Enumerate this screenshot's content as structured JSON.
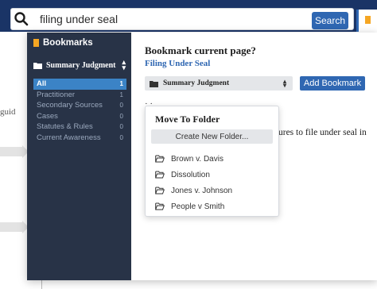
{
  "search": {
    "value": "filing under seal",
    "button_label": "Search",
    "icon": "search-icon"
  },
  "background": {
    "left_fragment": "guid",
    "right_fragment": "ures to file under seal in",
    "under_select_fragment": "· ·"
  },
  "sidebar": {
    "header": "Bookmarks",
    "selected_folder": "Summary Judgment",
    "items": [
      {
        "label": "All",
        "count": "1",
        "active": true
      },
      {
        "label": "Practitioner",
        "count": "1",
        "active": false
      },
      {
        "label": "Secondary Sources",
        "count": "0",
        "active": false
      },
      {
        "label": "Cases",
        "count": "0",
        "active": false
      },
      {
        "label": "Statutes & Rules",
        "count": "0",
        "active": false
      },
      {
        "label": "Current Awareness",
        "count": "0",
        "active": false
      }
    ]
  },
  "main": {
    "title": "Bookmark current page?",
    "page_name": "Filing Under Seal",
    "folder_select_value": "Summary Judgment",
    "add_button": "Add Bookmark"
  },
  "move_to_folder": {
    "title": "Move To Folder",
    "new_folder_button": "Create New Folder...",
    "folders": [
      "Brown v. Davis",
      "Dissolution",
      "Jones v. Johnson",
      "People v Smith"
    ]
  },
  "colors": {
    "topbar": "#1a3466",
    "sidebar": "#283347",
    "accent": "#2f67b2",
    "active_item": "#3b83c6",
    "bookmark_flag": "#f5a623"
  }
}
